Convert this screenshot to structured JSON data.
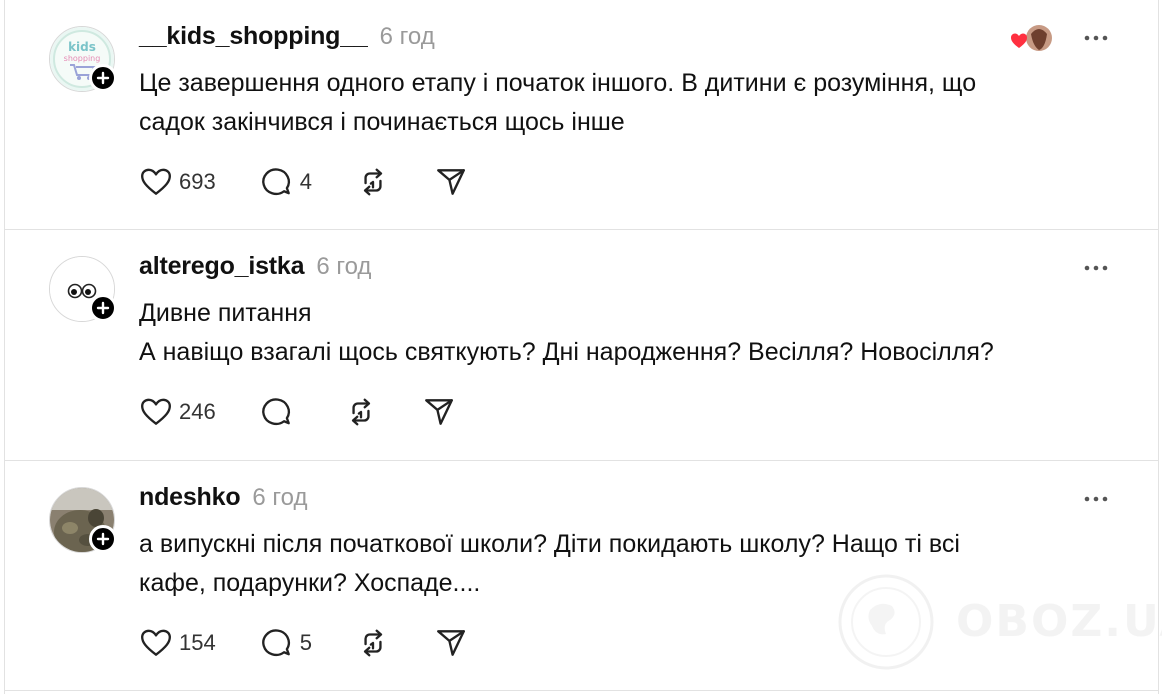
{
  "posts": [
    {
      "username": "__kids_shopping__",
      "time": "6 год",
      "avatar_icon": "kids-shopping-logo",
      "avatar_text": "kids shopping",
      "text_lines": [
        "Це завершення одного етапу і початок іншого. В дитини є розуміння, що",
        "садок закінчився і починається щось інше"
      ],
      "likes": "693",
      "replies": "4"
    },
    {
      "username": "alterego_istka",
      "time": "6 год",
      "avatar_icon": "eyes-avatar",
      "text_lines": [
        "Дивне питання",
        "А навіщо взагалі щось святкують? Дні народження? Весілля? Новосілля?"
      ],
      "likes": "246",
      "replies": ""
    },
    {
      "username": "ndeshko",
      "time": "6 год",
      "avatar_icon": "photo-avatar",
      "text_lines": [
        "а випускні після початкової школи? Діти покидають школу? Нащо ті всі",
        "кафе, подарунки? Хоспаде...."
      ],
      "likes": "154",
      "replies": "5"
    }
  ],
  "watermark": "OBOZ.UA",
  "colors": {
    "accent_heart": "#ff3040",
    "text": "#101010",
    "muted": "#9a9a9a",
    "divider": "#e2e2e2"
  }
}
